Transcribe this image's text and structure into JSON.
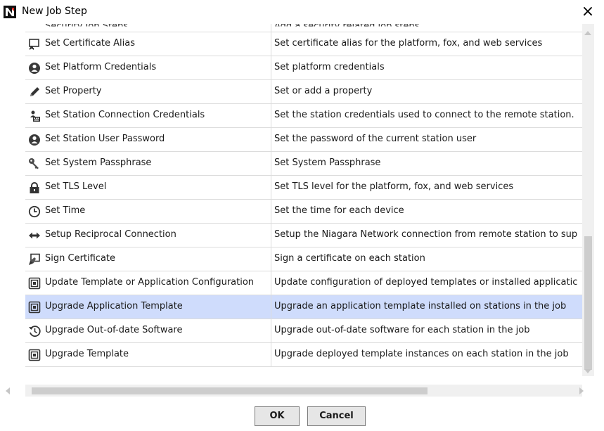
{
  "window": {
    "title": "New Job Step",
    "close_glyph": "×",
    "logo_icon": "niagara-n-logo"
  },
  "table": {
    "partial_top_row": {
      "name": "Security Job Steps",
      "description": "Add a security related job steps"
    },
    "rows": [
      {
        "icon": "certificate-icon",
        "name": "Set Certificate Alias",
        "description": "Set certificate alias for the platform, fox, and web services"
      },
      {
        "icon": "user-circle-icon",
        "name": "Set Platform Credentials",
        "description": "Set platform credentials"
      },
      {
        "icon": "pencil-icon",
        "name": "Set Property",
        "description": "Set or add a property"
      },
      {
        "icon": "user-keyboard-icon",
        "name": "Set Station Connection Credentials",
        "description": "Set the station credentials used to connect to the remote station."
      },
      {
        "icon": "user-circle-icon",
        "name": "Set Station User Password",
        "description": "Set the password of the current station user"
      },
      {
        "icon": "key-icon",
        "name": "Set System Passphrase",
        "description": "Set System Passphrase"
      },
      {
        "icon": "lock-icon",
        "name": "Set TLS Level",
        "description": "Set TLS level for the platform, fox, and web services"
      },
      {
        "icon": "clock-icon",
        "name": "Set Time",
        "description": "Set the time for each device"
      },
      {
        "icon": "double-arrow-icon",
        "name": "Setup Reciprocal Connection",
        "description": "Setup the Niagara Network connection from remote station to sup"
      },
      {
        "icon": "sign-certificate-icon",
        "name": "Sign Certificate",
        "description": "Sign a certificate on each station"
      },
      {
        "icon": "template-icon",
        "name": "Update Template or Application Configuration",
        "description": "Update configuration of deployed templates or installed applicatic"
      },
      {
        "icon": "template-icon",
        "name": "Upgrade Application Template",
        "description": "Upgrade an application template installed on stations in the job",
        "selected": true
      },
      {
        "icon": "history-icon",
        "name": "Upgrade Out-of-date Software",
        "description": "Upgrade out-of-date software for each station in the job"
      },
      {
        "icon": "template-icon",
        "name": "Upgrade Template",
        "description": "Upgrade deployed template instances on each station in the job"
      }
    ]
  },
  "buttons": {
    "ok_label": "OK",
    "cancel_label": "Cancel"
  },
  "colors": {
    "selected_row": "#cfdcfc",
    "grid_line": "#dcdcdc",
    "icon_dark": "#4a4a4a"
  }
}
